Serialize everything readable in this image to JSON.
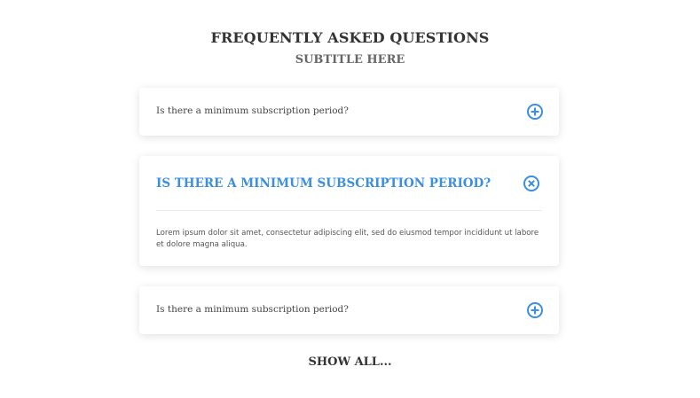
{
  "header": {
    "title": "FREQUENTLY ASKED QUESTIONS",
    "subtitle": "SUBTITLE HERE"
  },
  "faq": {
    "items": [
      {
        "question": "Is there a minimum subscription period?",
        "expanded": false,
        "icon": "plus-circle-icon"
      },
      {
        "question": "IS THERE A MINIMUM SUBSCRIPTION PERIOD?",
        "expanded": true,
        "icon": "close-circle-icon",
        "answer": "Lorem ipsum dolor sit amet, consectetur adipiscing elit, sed do eiusmod tempor incididunt ut labore et dolore magna aliqua."
      },
      {
        "question": "Is there a minimum subscription period?",
        "expanded": false,
        "icon": "plus-circle-icon"
      }
    ]
  },
  "footer": {
    "show_all_label": "SHOW ALL..."
  },
  "colors": {
    "accent": "#3b8fe0",
    "title": "#333333",
    "subtitle": "#666666"
  }
}
